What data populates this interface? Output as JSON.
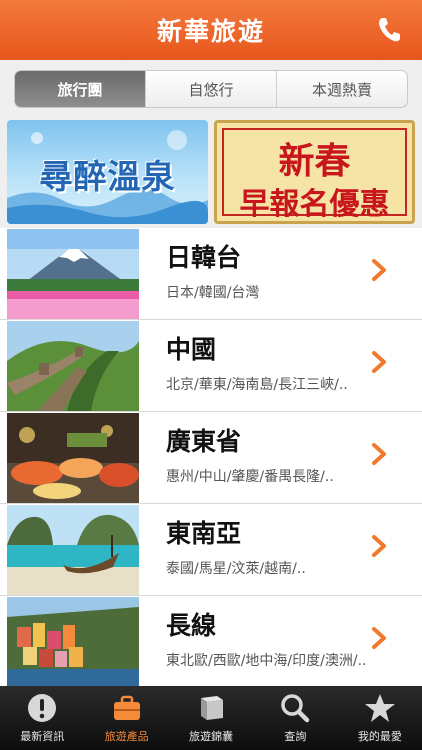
{
  "header": {
    "title": "新華旅遊",
    "icon": "phone-icon"
  },
  "segments": [
    {
      "label": "旅行團",
      "active": true
    },
    {
      "label": "自悠行",
      "active": false
    },
    {
      "label": "本週熱賣",
      "active": false
    }
  ],
  "banners": {
    "left_text": "尋醉溫泉",
    "right_line1": "新春",
    "right_line2": "早報名優惠"
  },
  "destinations": [
    {
      "name": "日韓台",
      "sub": "日本/韓國/台灣",
      "photo": "mount-fuji-photo"
    },
    {
      "name": "中國",
      "sub": "北京/華東/海南島/長江三峽/..",
      "photo": "great-wall-photo"
    },
    {
      "name": "廣東省",
      "sub": "惠州/中山/肇慶/番禺長隆/..",
      "photo": "seafood-buffet-photo"
    },
    {
      "name": "東南亞",
      "sub": "泰國/馬星/汶萊/越南/..",
      "photo": "thai-beach-photo"
    },
    {
      "name": "長線",
      "sub": "東北歐/西歐/地中海/印度/澳洲/..",
      "photo": "cinque-terre-photo"
    }
  ],
  "tabbar": [
    {
      "label": "最新資訊",
      "icon": "exclamation-icon",
      "active": false
    },
    {
      "label": "旅遊產品",
      "icon": "suitcase-icon",
      "active": true
    },
    {
      "label": "旅遊錦囊",
      "icon": "book-icon",
      "active": false
    },
    {
      "label": "查詢",
      "icon": "search-icon",
      "active": false
    },
    {
      "label": "我的最愛",
      "icon": "star-icon",
      "active": false
    }
  ],
  "colors": {
    "brand_orange": "#ef6a2b",
    "tab_active": "#f58a3a",
    "chevron": "#f07a2e"
  }
}
